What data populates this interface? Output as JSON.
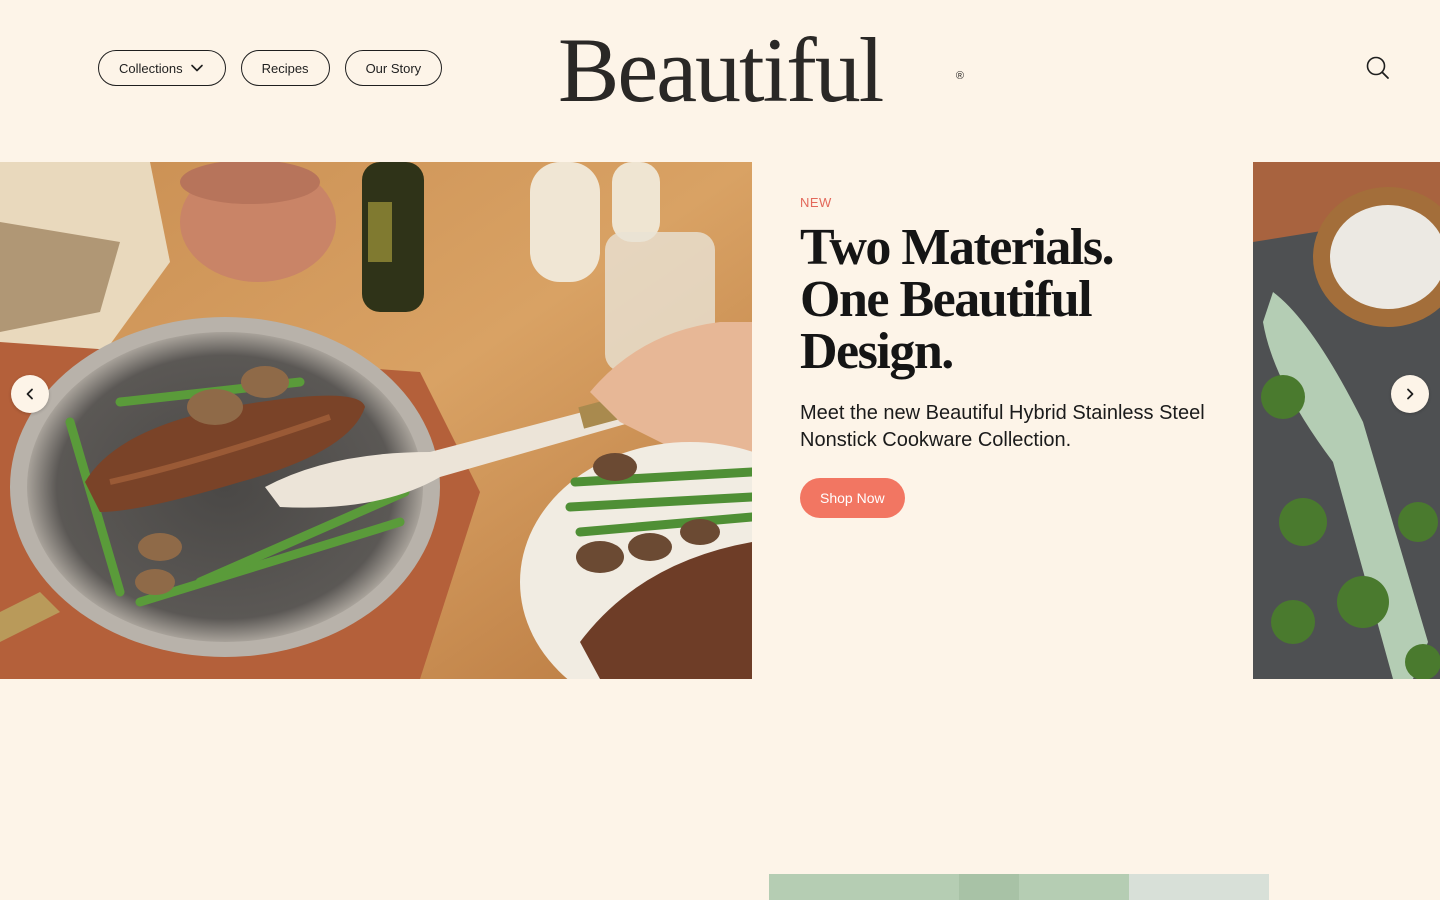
{
  "header": {
    "nav": [
      {
        "label": "Collections",
        "has_dropdown": true
      },
      {
        "label": "Recipes",
        "has_dropdown": false
      },
      {
        "label": "Our Story",
        "has_dropdown": false
      }
    ],
    "logo_text": "Beautiful",
    "logo_mark": "®",
    "search_icon": "search-icon"
  },
  "hero": {
    "eyebrow": "NEW",
    "headline_line1": "Two Materials.",
    "headline_line2": "One Beautiful",
    "headline_line3": "Design.",
    "subtext": "Meet the new Beautiful Hybrid Stainless Steel Nonstick Cookware Collection.",
    "cta_label": "Shop Now",
    "prev_icon": "chevron-left-icon",
    "next_icon": "chevron-right-icon"
  },
  "colors": {
    "background": "#fdf4e8",
    "accent": "#f27662",
    "eyebrow": "#e3685a",
    "text": "#1f1f1f"
  }
}
